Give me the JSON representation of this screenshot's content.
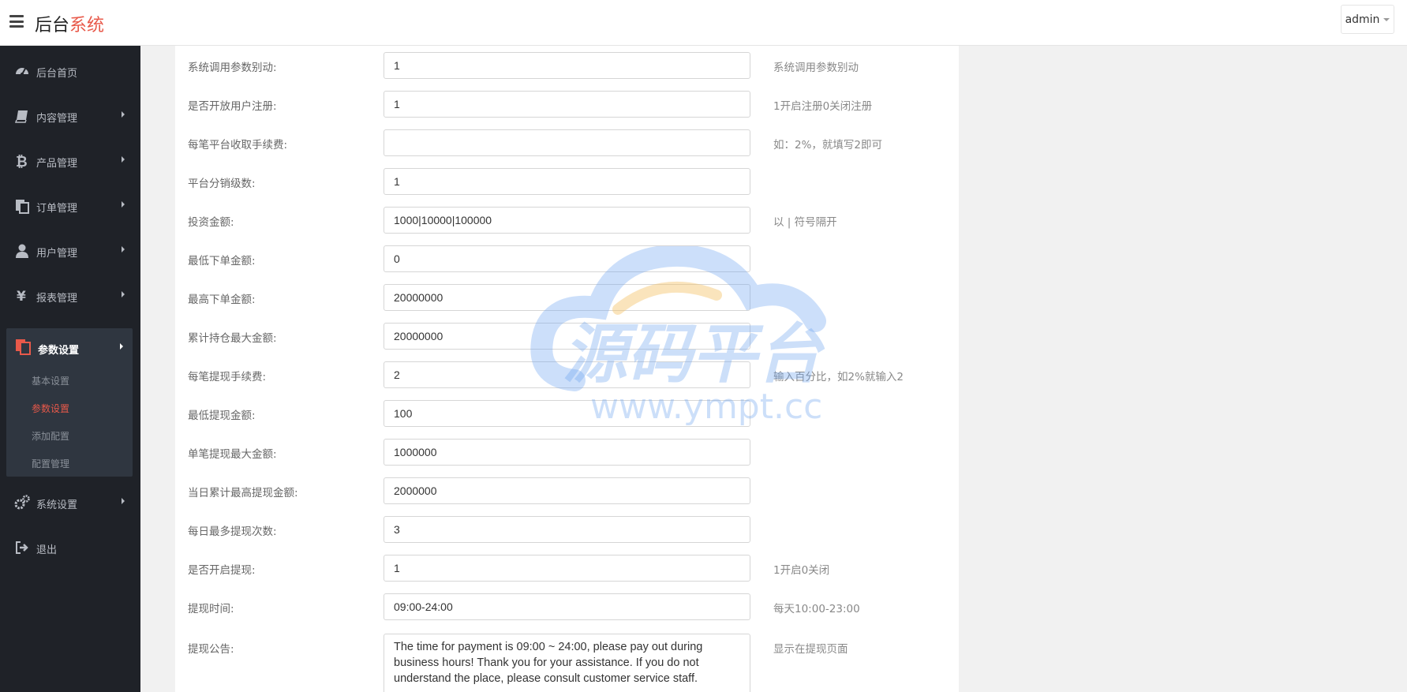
{
  "header": {
    "brand_part1": "后台",
    "brand_part2": "系统",
    "admin_label": "admin"
  },
  "sidebar": {
    "items": [
      {
        "label": "后台首页",
        "icon": "dashboard-icon"
      },
      {
        "label": "内容管理",
        "icon": "book-icon"
      },
      {
        "label": "产品管理",
        "icon": "bitcoin-icon"
      },
      {
        "label": "订单管理",
        "icon": "copy-icon"
      },
      {
        "label": "用户管理",
        "icon": "user-icon"
      },
      {
        "label": "报表管理",
        "icon": "yen-icon"
      },
      {
        "label": "参数设置",
        "icon": "files-icon"
      },
      {
        "label": "系统设置",
        "icon": "gears-icon"
      },
      {
        "label": "退出",
        "icon": "sign-out-icon"
      }
    ],
    "subitems": [
      "基本设置",
      "参数设置",
      "添加配置",
      "配置管理"
    ]
  },
  "form": {
    "rows": [
      {
        "label": "系统调用参数别动:",
        "value": "1",
        "hint": "系统调用参数别动"
      },
      {
        "label": "是否开放用户注册:",
        "value": "1",
        "hint": "1开启注册0关闭注册"
      },
      {
        "label": "每笔平台收取手续费:",
        "value": "",
        "hint": "如：2%，就填写2即可"
      },
      {
        "label": "平台分销级数:",
        "value": "1",
        "hint": ""
      },
      {
        "label": "投资金额:",
        "value": "1000|10000|100000",
        "hint": "以 | 符号隔开"
      },
      {
        "label": "最低下单金额:",
        "value": "0",
        "hint": ""
      },
      {
        "label": "最高下单金额:",
        "value": "20000000",
        "hint": ""
      },
      {
        "label": "累计持仓最大金额:",
        "value": "20000000",
        "hint": ""
      },
      {
        "label": "每笔提现手续费:",
        "value": "2",
        "hint": "输入百分比，如2%就输入2"
      },
      {
        "label": "最低提现金额:",
        "value": "100",
        "hint": ""
      },
      {
        "label": "单笔提现最大金额:",
        "value": "1000000",
        "hint": ""
      },
      {
        "label": "当日累计最高提现金额:",
        "value": "2000000",
        "hint": ""
      },
      {
        "label": "每日最多提现次数:",
        "value": "3",
        "hint": ""
      },
      {
        "label": "是否开启提现:",
        "value": "1",
        "hint": "1开启0关闭"
      },
      {
        "label": "提现时间:",
        "value": "09:00-24:00",
        "hint": "每天10:00-23:00"
      }
    ],
    "notice": {
      "label": "提现公告:",
      "value": "The time for payment is 09:00 ~ 24:00, please pay out during business hours! Thank you for your assistance. If you do not understand the place, please consult customer service staff.",
      "hint": "显示在提现页面"
    }
  },
  "watermark": {
    "text_cn": "源码平台",
    "text_url": "www.ympt.cc"
  },
  "colors": {
    "accent": "#e8594a",
    "sidebar_bg": "#1f2228",
    "sidebar_active_bg": "#2f3640",
    "watermark_blue": "#6ea4f0",
    "watermark_orange": "#f5c46a"
  }
}
